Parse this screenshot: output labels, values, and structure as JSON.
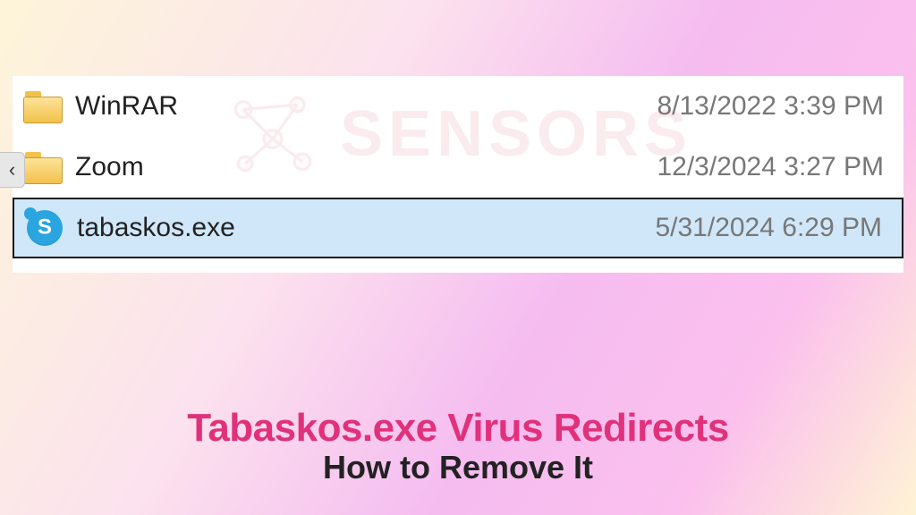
{
  "watermark": {
    "text": "SENSORS"
  },
  "files": [
    {
      "name": "WinRAR",
      "date": "8/13/2022 3:39 PM",
      "icon": "folder",
      "selected": false
    },
    {
      "name": "Zoom",
      "date": "12/3/2024 3:27 PM",
      "icon": "folder",
      "selected": false
    },
    {
      "name": "tabaskos.exe",
      "date": "5/31/2024 6:29 PM",
      "icon": "skype",
      "selected": true
    }
  ],
  "nav": {
    "back": "‹"
  },
  "caption": {
    "line1": "Tabaskos.exe Virus Redirects",
    "line2": "How to Remove It"
  }
}
